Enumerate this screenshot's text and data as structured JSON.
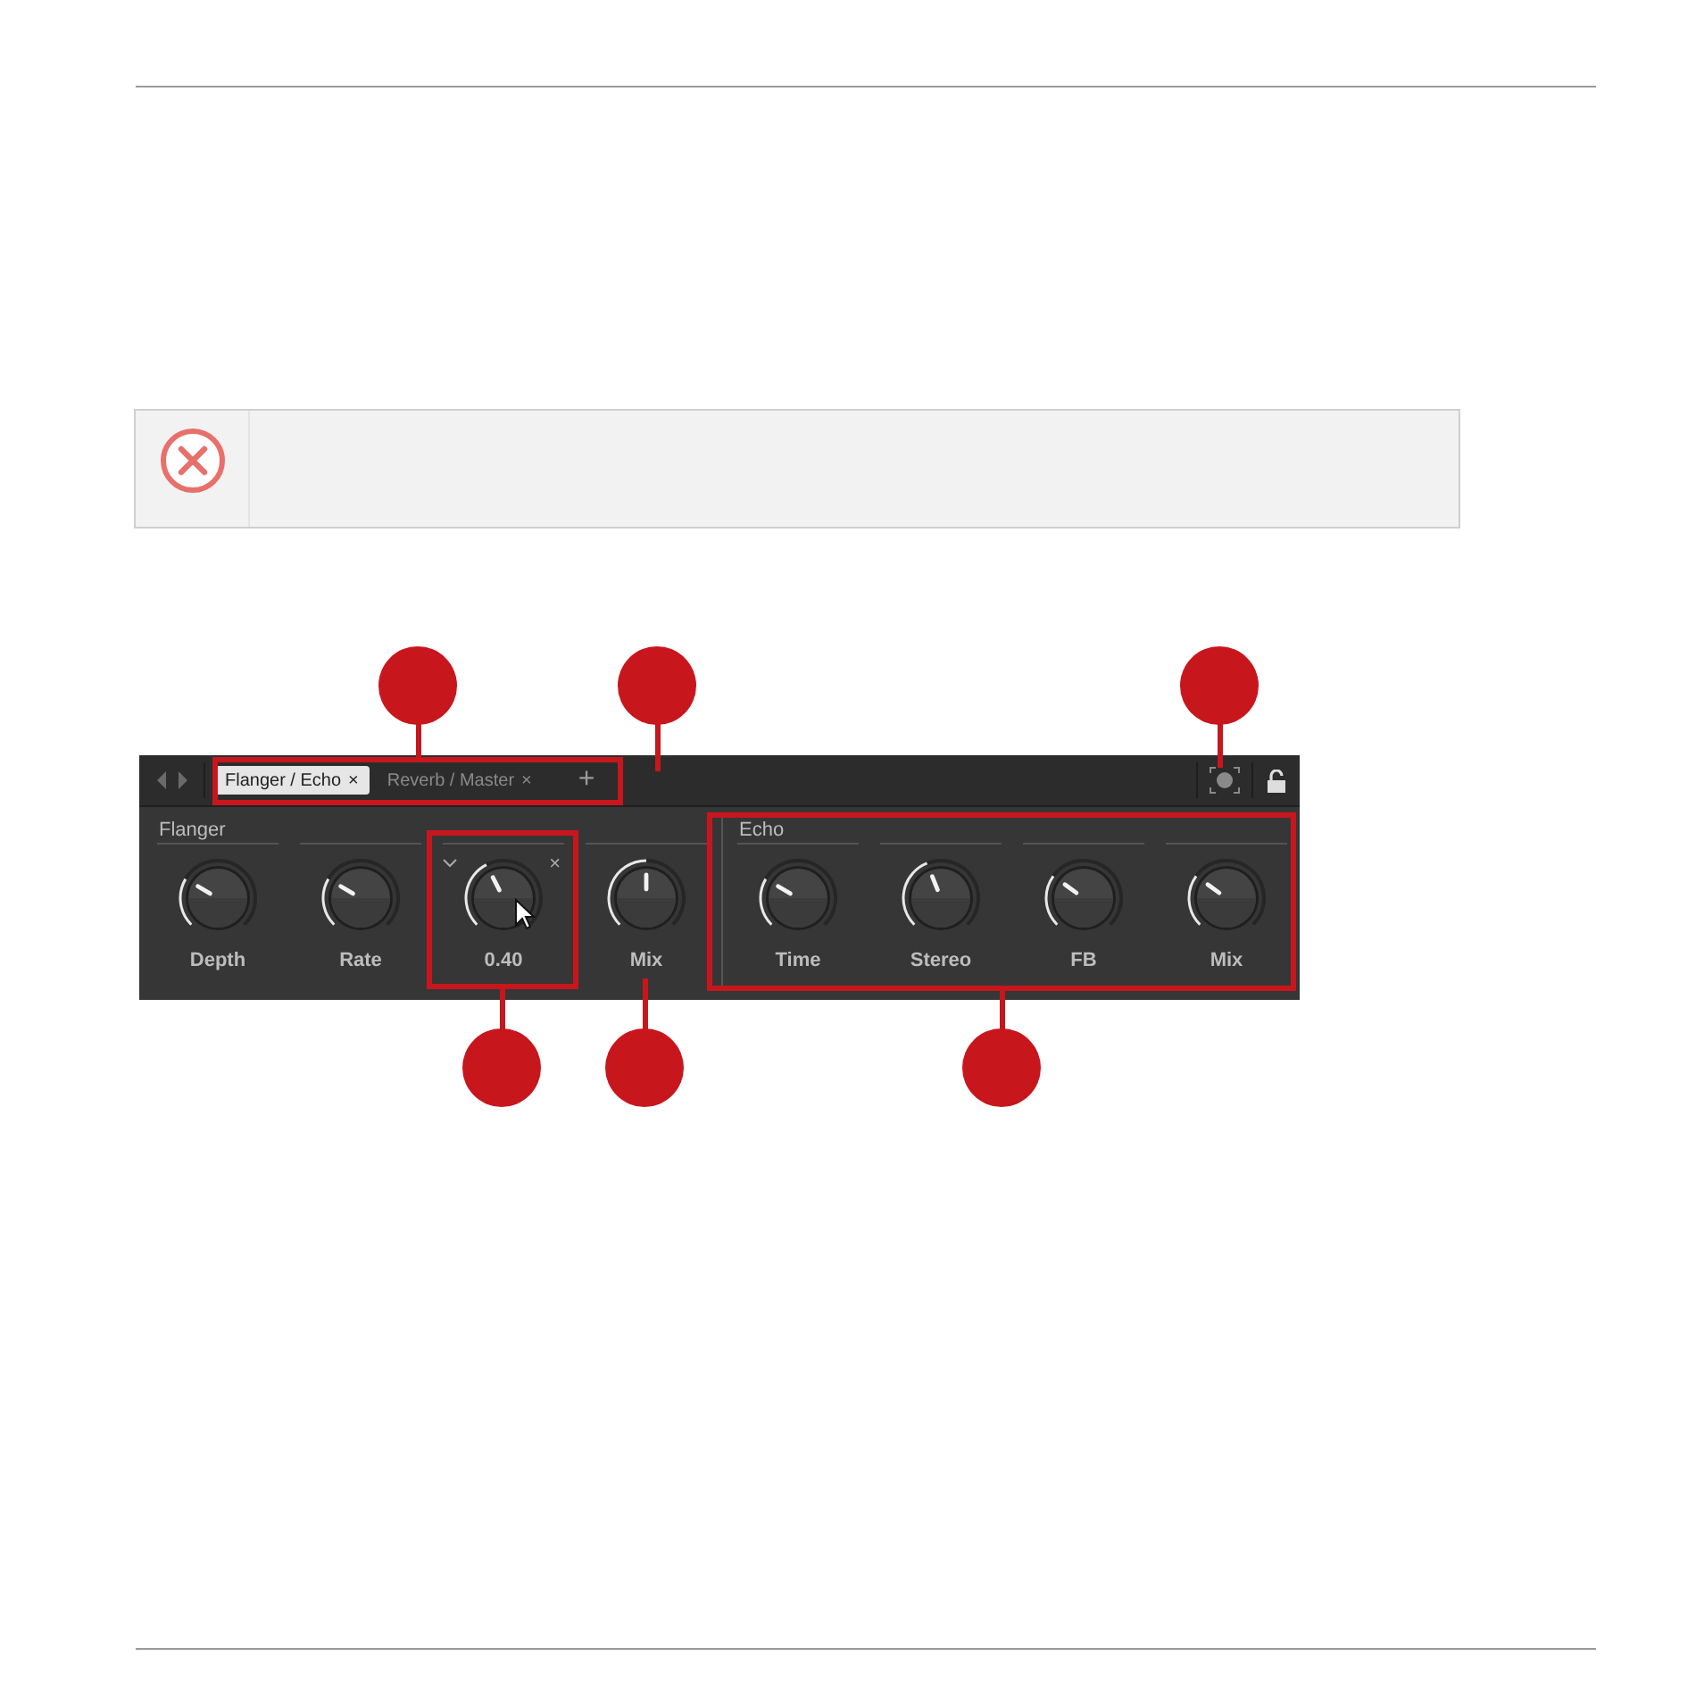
{
  "toolbar": {
    "tabs": [
      {
        "label": "Flanger / Echo",
        "close": "×",
        "selected": true
      },
      {
        "label": "Reverb / Master",
        "close": "×",
        "selected": false
      }
    ],
    "add": "+"
  },
  "sections": [
    {
      "title": "Flanger",
      "controls": [
        {
          "label": "Depth",
          "kind": "knob"
        },
        {
          "label": "Rate",
          "kind": "knob"
        },
        {
          "label": "0.40",
          "kind": "focused",
          "close": "×"
        },
        {
          "label": "Mix",
          "kind": "knob"
        }
      ]
    },
    {
      "title": "Echo",
      "controls": [
        {
          "label": "Time",
          "kind": "knob"
        },
        {
          "label": "Stereo",
          "kind": "knob"
        },
        {
          "label": "FB",
          "kind": "knob"
        },
        {
          "label": "Mix",
          "kind": "knob"
        }
      ]
    }
  ]
}
